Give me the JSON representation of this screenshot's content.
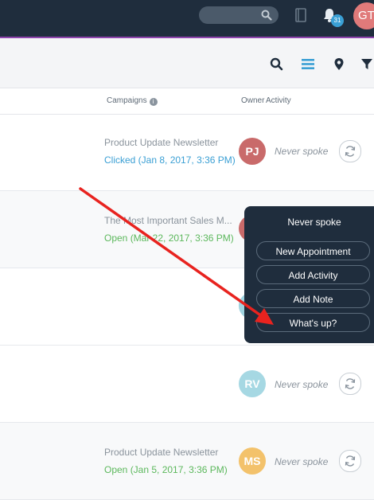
{
  "navbar": {
    "notification_count": "31",
    "user_initials": "GT"
  },
  "toolbar": {
    "icons": [
      "search-icon",
      "list-icon",
      "map-pin-icon",
      "filter-icon"
    ]
  },
  "columns": {
    "campaigns": "Campaigns",
    "owner": "Owner",
    "activity": "Activity"
  },
  "rows": [
    {
      "campaign_title": "Product Update Newsletter",
      "campaign_status": "Clicked (Jan 8, 2017, 3:36 PM)",
      "owner_initials": "PJ",
      "owner_color": "#c96a6a",
      "activity": "Never spoke"
    },
    {
      "campaign_title": "The Most Important Sales M...",
      "campaign_status": "Open (Mar 22, 2017, 3:36 PM)",
      "owner_initials": "",
      "owner_color": "#c96a6a",
      "activity": ""
    },
    {
      "campaign_title": "",
      "campaign_status": "",
      "owner_initials": "",
      "owner_color": "#9fd3e0",
      "activity": ""
    },
    {
      "campaign_title": "",
      "campaign_status": "",
      "owner_initials": "RV",
      "owner_color": "#a6d8e3",
      "activity": "Never spoke"
    },
    {
      "campaign_title": "Product Update Newsletter",
      "campaign_status": "Open (Jan 5, 2017, 3:36 PM)",
      "owner_initials": "MS",
      "owner_color": "#f3c26b",
      "activity": "Never spoke"
    }
  ],
  "popover": {
    "title": "Never spoke",
    "buttons": [
      "New Appointment",
      "Add Activity",
      "Add Note",
      "What's up?"
    ]
  },
  "colors": {
    "navbar": "#1f2d3d",
    "accent_line": "#8e44ad",
    "link_blue": "#3a9fd4",
    "status_green": "#5cb85c",
    "annotation_arrow": "#e8231f"
  }
}
